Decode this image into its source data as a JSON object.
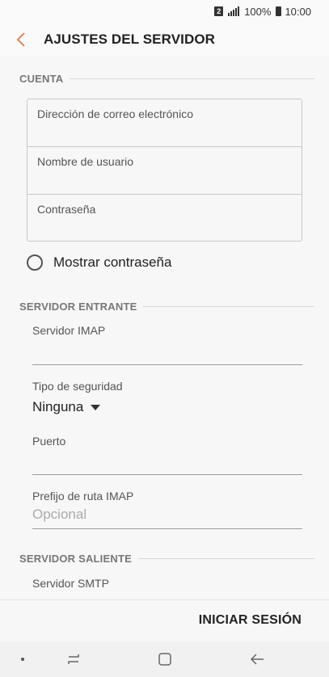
{
  "status": {
    "sim": "2",
    "battery": "100%",
    "time": "10:00"
  },
  "header": {
    "title": "AJUSTES DEL SERVIDOR"
  },
  "account": {
    "section": "CUENTA",
    "email_label": "Dirección de correo electrónico",
    "username_label": "Nombre de usuario",
    "password_label": "Contraseña",
    "show_password": "Mostrar contraseña"
  },
  "incoming": {
    "section": "SERVIDOR ENTRANTE",
    "imap_server_label": "Servidor IMAP",
    "security_label": "Tipo de seguridad",
    "security_value": "Ninguna",
    "port_label": "Puerto",
    "path_prefix_label": "Prefijo de ruta IMAP",
    "path_prefix_placeholder": "Opcional"
  },
  "outgoing": {
    "section": "SERVIDOR SALIENTE",
    "smtp_server_label": "Servidor SMTP"
  },
  "footer": {
    "signin": "INICIAR SESIÓN"
  },
  "colors": {
    "accent": "#e8845a",
    "background": "#f7f7f7"
  }
}
